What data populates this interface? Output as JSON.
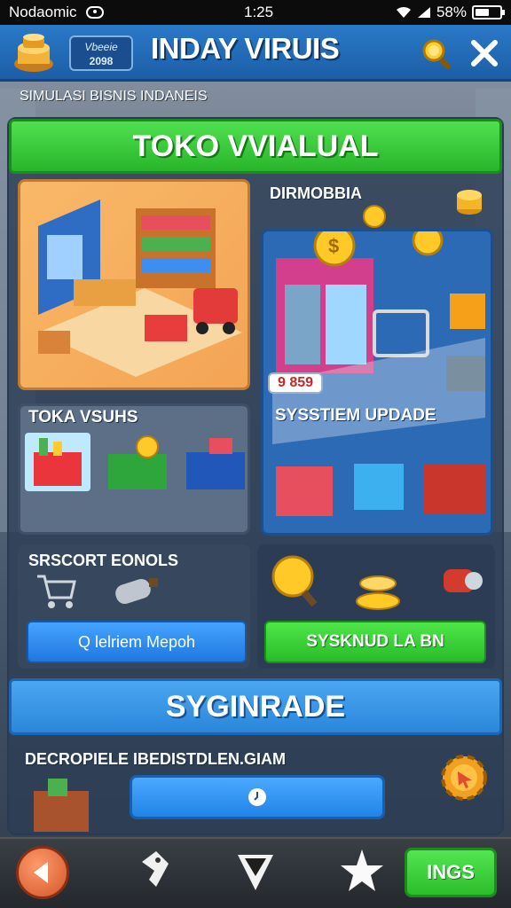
{
  "status_bar": {
    "carrier": "Nodaomic",
    "time": "1:25",
    "battery": "58%",
    "battery_level": 0.58
  },
  "header": {
    "badge_line1": "Vbeeie",
    "badge_line2": "2098",
    "title": "INDAY VIRUIS"
  },
  "subtitle": "SIMULASI BISNIS INDANEIS",
  "main_banner": "TOKO VVIALUAL",
  "shop_section": {
    "label": "DIRMOBBIA",
    "price": "9 859"
  },
  "visits_section": {
    "label": "TOKA VSUHS"
  },
  "update_section": {
    "label": "SYSSTIEM UPDADE"
  },
  "support_section": {
    "label": "SRSCORT EONOLS",
    "blue_button": "Q lelriem Mepoh",
    "green_button": "SYSKNUD LA BN"
  },
  "upgrade_banner": "SYGINRADE",
  "description": {
    "text": "DECROPIELE IBEDISTDLEN.GIAM"
  },
  "bottom_nav": {
    "action_button": "INGS"
  },
  "colors": {
    "header_blue": "#2a79c8",
    "accent_green": "#3fd23f",
    "button_blue": "#2f8ef0",
    "shop_orange": "#f4a455"
  },
  "icons": [
    "wifi-icon",
    "signal-icon",
    "battery-icon",
    "logo-icon",
    "search-icon",
    "close-icon",
    "gear-icon",
    "back-icon",
    "tag-icon",
    "crystal-icon",
    "star-icon",
    "clock-icon"
  ]
}
